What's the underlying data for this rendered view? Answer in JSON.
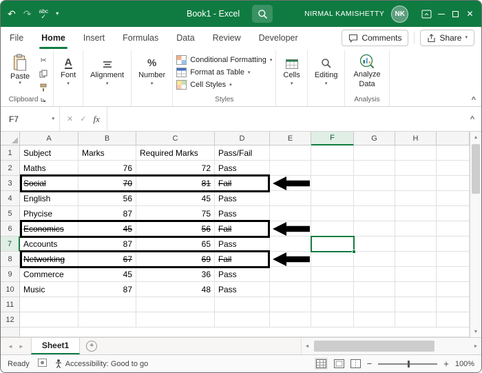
{
  "window": {
    "title": "Book1 - Excel",
    "user": {
      "name": "NIRMAL KAMISHETTY",
      "initials": "NK"
    }
  },
  "icons": {
    "dropdown": "▾",
    "collapse_ribbon": "^",
    "undo": "↶",
    "redo": "↷",
    "spellcheck_text": "abc",
    "check": "✓",
    "cancel": "✕",
    "close": "✕",
    "cut": "✂",
    "font_a": "A",
    "percent": "%",
    "nav_left": "◄",
    "nav_right": "►",
    "scroll_up": "▲",
    "scroll_down": "▼",
    "add_sheet": "+",
    "zoom_out": "−",
    "zoom_in": "+"
  },
  "ribbon": {
    "tabs": [
      "File",
      "Home",
      "Insert",
      "Formulas",
      "Data",
      "Review",
      "Developer"
    ],
    "active_tab": "Home",
    "comments": "Comments",
    "share": "Share",
    "clipboard": {
      "label": "Clipboard",
      "paste": "Paste"
    },
    "font": {
      "label": "Font"
    },
    "alignment": {
      "label": "Alignment"
    },
    "number": {
      "label": "Number"
    },
    "styles": {
      "label": "Styles",
      "conditional": "Conditional Formatting",
      "format_table": "Format as Table",
      "cell_styles": "Cell Styles"
    },
    "cells": {
      "label": "Cells"
    },
    "editing": {
      "label": "Editing"
    },
    "analysis": {
      "label": "Analysis",
      "analyze_line1": "Analyze",
      "analyze_line2": "Data"
    }
  },
  "formula_bar": {
    "name_box": "F7",
    "fx": "fx",
    "value": ""
  },
  "sheet": {
    "columns": [
      "A",
      "B",
      "C",
      "D",
      "E",
      "F",
      "G",
      "H"
    ],
    "selected_cell": "F7",
    "selected_column": "F",
    "selected_row": 7,
    "rows": [
      {
        "n": 1,
        "cells": [
          "Subject",
          "Marks",
          "Required Marks",
          "Pass/Fail"
        ],
        "strike": false,
        "annotated": false
      },
      {
        "n": 2,
        "cells": [
          "Maths",
          "76",
          "72",
          "Pass"
        ],
        "strike": false,
        "annotated": false
      },
      {
        "n": 3,
        "cells": [
          "Social",
          "70",
          "81",
          "Fail"
        ],
        "strike": true,
        "annotated": true
      },
      {
        "n": 4,
        "cells": [
          "English",
          "56",
          "45",
          "Pass"
        ],
        "strike": false,
        "annotated": false
      },
      {
        "n": 5,
        "cells": [
          "Phycise",
          "87",
          "75",
          "Pass"
        ],
        "strike": false,
        "annotated": false
      },
      {
        "n": 6,
        "cells": [
          "Economics",
          "45",
          "56",
          "Fail"
        ],
        "strike": true,
        "annotated": true
      },
      {
        "n": 7,
        "cells": [
          "Accounts",
          "87",
          "65",
          "Pass"
        ],
        "strike": false,
        "annotated": false
      },
      {
        "n": 8,
        "cells": [
          "Networking",
          "67",
          "69",
          "Fail"
        ],
        "strike": true,
        "annotated": true
      },
      {
        "n": 9,
        "cells": [
          "Commerce",
          "45",
          "36",
          "Pass"
        ],
        "strike": false,
        "annotated": false
      },
      {
        "n": 10,
        "cells": [
          "Music",
          "87",
          "48",
          "Pass"
        ],
        "strike": false,
        "annotated": false
      },
      {
        "n": 11,
        "cells": [
          "",
          "",
          "",
          ""
        ],
        "strike": false,
        "annotated": false
      },
      {
        "n": 12,
        "cells": [
          "",
          "",
          "",
          ""
        ],
        "strike": false,
        "annotated": false
      }
    ]
  },
  "tabs_bar": {
    "sheet_name": "Sheet1"
  },
  "status_bar": {
    "ready": "Ready",
    "accessibility": "Accessibility: Good to go",
    "zoom": "100%"
  }
}
